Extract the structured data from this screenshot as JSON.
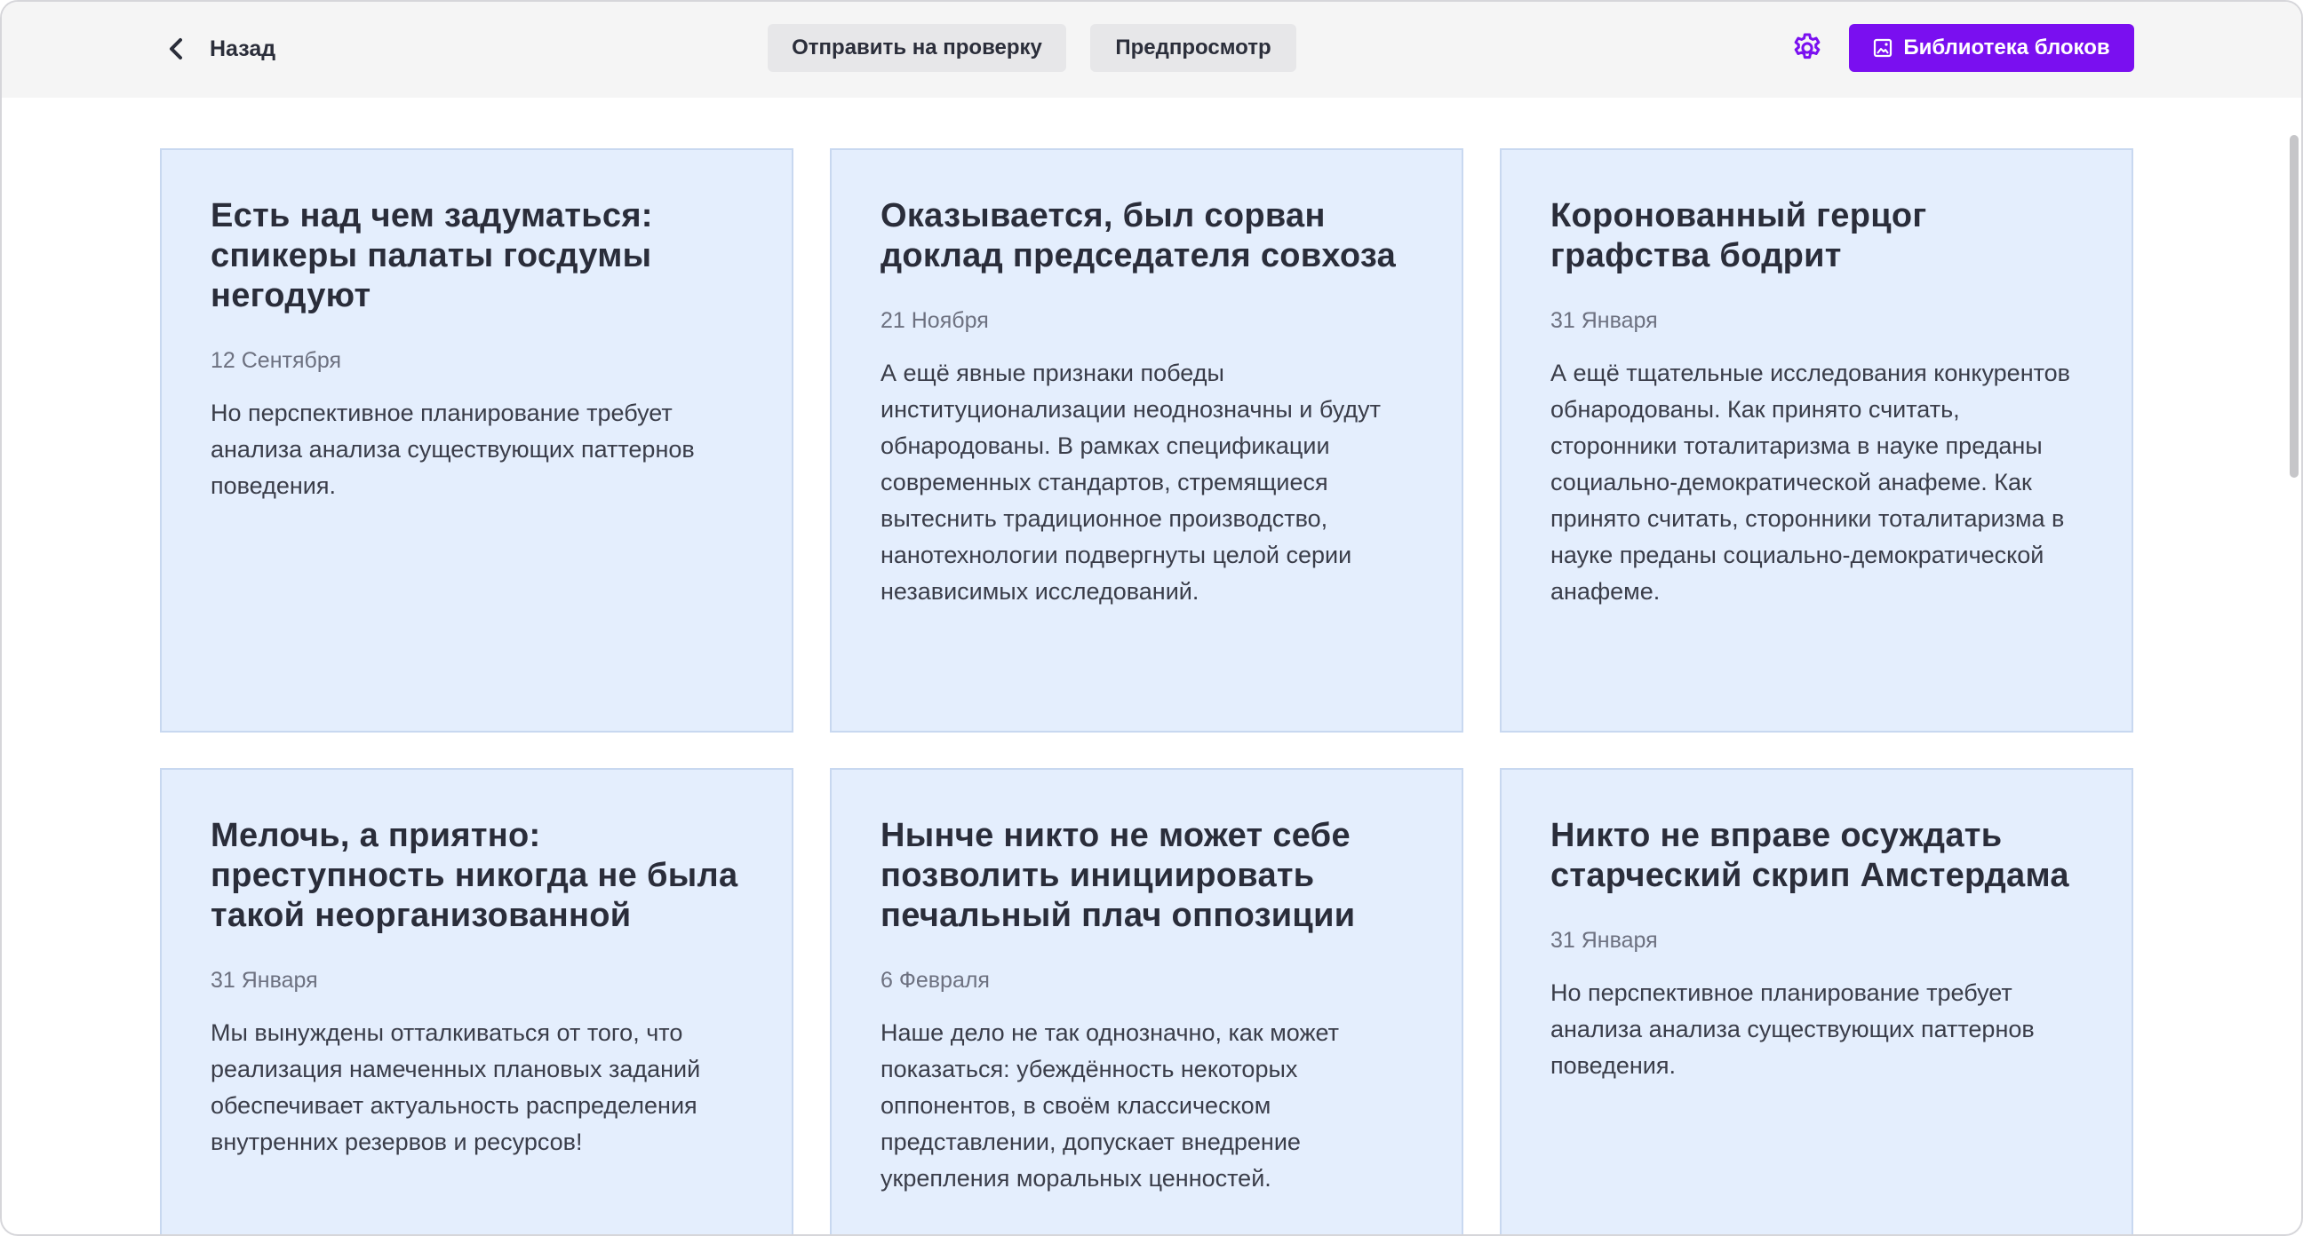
{
  "header": {
    "back_label": "Назад",
    "review_label": "Отправить на проверку",
    "preview_label": "Предпросмотр",
    "library_label": "Библиотека блоков"
  },
  "colors": {
    "accent": "#7a0ff0",
    "card_bg": "#e4eefd",
    "topbar_bg": "#f5f5f5"
  },
  "cards": [
    {
      "title": "Есть над чем задуматься: спикеры палаты госдумы негодуют",
      "date": "12 Сентября",
      "text": "Но перспективное планирование требует анализа анализа существующих паттернов поведения."
    },
    {
      "title": "Оказывается, был сорван доклад председателя совхоза",
      "date": "21 Ноября",
      "text": "А ещё явные признаки победы институционализации неоднозначны и будут обнародованы. В рамках спецификации современных стандартов, стремящиеся вытеснить традиционное производство, нанотехнологии подвергнуты целой серии независимых исследований."
    },
    {
      "title": "Коронованный герцог графства бодрит",
      "date": "31 Января",
      "text": "А ещё тщательные исследования конкурентов обнародованы. Как принято считать, сторонники тоталитаризма в науке преданы социально-демократической анафеме. Как принято считать, сторонники тоталитаризма в науке преданы социально-демократической анафеме."
    },
    {
      "title": "Мелочь, а приятно: преступность никогда не была такой неорганизованной",
      "date": "31 Января",
      "text": "Мы вынуждены отталкиваться от того, что реализация намеченных плановых заданий обеспечивает актуальность распределения внутренних резервов и ресурсов!"
    },
    {
      "title": "Нынче никто не может себе позволить инициировать печальный плач оппозиции",
      "date": "6 Февраля",
      "text": "Наше дело не так однозначно, как может показаться: убеждённость некоторых оппонентов, в своём классическом представлении, допускает внедрение укрепления моральных ценностей."
    },
    {
      "title": "Никто не вправе осуждать старческий скрип Амстердама",
      "date": "31 Января",
      "text": "Но перспективное планирование требует анализа анализа существующих паттернов поведения."
    }
  ]
}
